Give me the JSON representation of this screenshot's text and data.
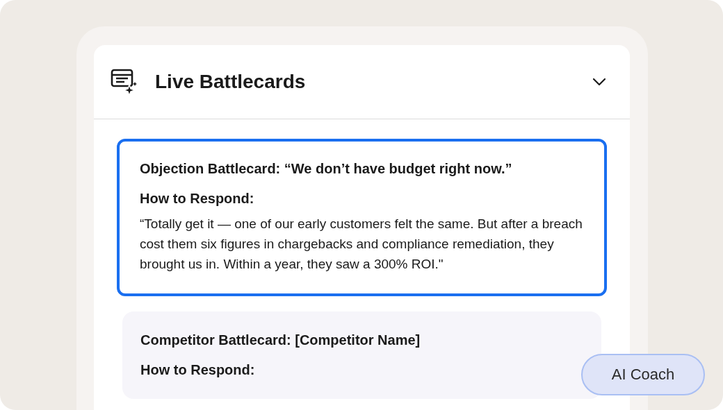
{
  "panel": {
    "title": "Live Battlecards",
    "expanded": true
  },
  "cards": [
    {
      "title": "Objection Battlecard: “We don’t have budget right now.”",
      "subtitle": "How to Respond:",
      "body": "“Totally get it — one of our early customers felt the same. But after a breach cost them six figures in chargebacks and compliance remediation, they brought us in. Within a year, they saw a 300% ROI.\"",
      "selected": true
    },
    {
      "title": "Competitor Battlecard: [Competitor Name]",
      "subtitle": "How to Respond:",
      "selected": false
    }
  ],
  "coach_button": {
    "label": "AI Coach"
  }
}
